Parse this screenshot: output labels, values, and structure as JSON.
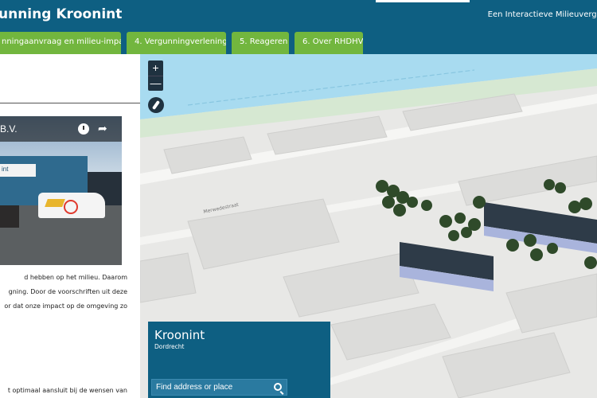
{
  "header": {
    "title": "unning Kroonint",
    "subtitle": "Een Interactieve Milieuvergu"
  },
  "tabs": [
    {
      "label": "nningaanvraag en milieu-impact"
    },
    {
      "label": "4. Vergunningverlening"
    },
    {
      "label": "5. Reageren"
    },
    {
      "label": "6. Over RHDHV"
    }
  ],
  "video": {
    "title": "B.V.",
    "sign": "int"
  },
  "body_text": [
    "d hebben op het milieu. Daarom",
    "gning. Door de voorschriften uit deze",
    "or dat onze impact op de omgeving zo",
    "t optimaal aansluit bij de wensen van"
  ],
  "map": {
    "zoom_in": "+",
    "zoom_out": "—",
    "street_label": "Merwedestraat",
    "info": {
      "title": "Kroonint",
      "subtitle": "Dordrecht",
      "search_placeholder": "Find address or place"
    }
  },
  "colors": {
    "header": "#0e5f82",
    "tab": "#72b63e",
    "map_ground": "#e8e8e6",
    "water": "#a8dbf0",
    "building": "#3b4a5a"
  },
  "icons": {
    "clock": "clock-icon",
    "share": "share-icon",
    "compass": "compass-icon",
    "search": "search-icon"
  }
}
